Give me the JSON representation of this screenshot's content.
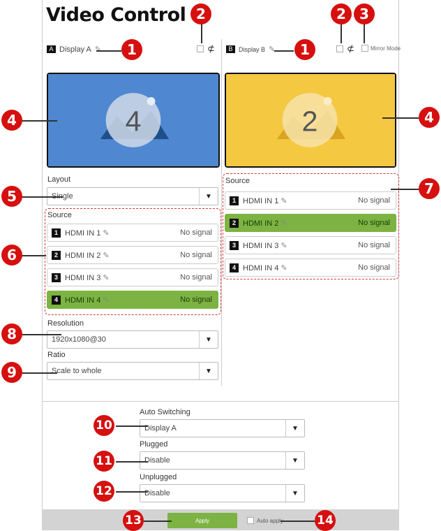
{
  "page_title": "Video Control",
  "display_a": {
    "letter": "A",
    "name": "Display A",
    "preview_number": "4",
    "preview_color": "#4f87d1"
  },
  "display_b": {
    "letter": "B",
    "name": "Display B",
    "preview_number": "2",
    "preview_color": "#f5c842"
  },
  "mirror_mode_label": "Mirror Mode",
  "layout": {
    "label": "Layout",
    "value": "Single"
  },
  "source_label": "Source",
  "sources_a": [
    {
      "num": "1",
      "name": "HDMI IN 1",
      "signal": "No signal",
      "active": false
    },
    {
      "num": "2",
      "name": "HDMI IN 2",
      "signal": "No signal",
      "active": false
    },
    {
      "num": "3",
      "name": "HDMI IN 3",
      "signal": "No signal",
      "active": false
    },
    {
      "num": "4",
      "name": "HDMI IN 4",
      "signal": "No signal",
      "active": true
    }
  ],
  "sources_b": [
    {
      "num": "1",
      "name": "HDMI IN 1",
      "signal": "No signal",
      "active": false
    },
    {
      "num": "2",
      "name": "HDMI IN 2",
      "signal": "No signal",
      "active": true
    },
    {
      "num": "3",
      "name": "HDMI IN 3",
      "signal": "No signal",
      "active": false
    },
    {
      "num": "4",
      "name": "HDMI IN 4",
      "signal": "No signal",
      "active": false
    }
  ],
  "resolution": {
    "label": "Resolution",
    "value": "1920x1080@30"
  },
  "ratio": {
    "label": "Ratio",
    "value": "Scale to whole"
  },
  "auto_switching": {
    "label": "Auto Switching",
    "value": "Display A"
  },
  "plugged": {
    "label": "Plugged",
    "value": "Disable"
  },
  "unplugged": {
    "label": "Unplugged",
    "value": "Disable"
  },
  "apply_label": "Apply",
  "auto_apply_label": "Auto apply",
  "callouts": [
    "1",
    "1",
    "2",
    "2",
    "3",
    "4",
    "4",
    "5",
    "6",
    "7",
    "8",
    "9",
    "10",
    "11",
    "12",
    "13",
    "14"
  ],
  "colors": {
    "accent_green": "#7cb342",
    "callout_red": "#d60f0f",
    "dashed_red": "#d23a3a"
  }
}
